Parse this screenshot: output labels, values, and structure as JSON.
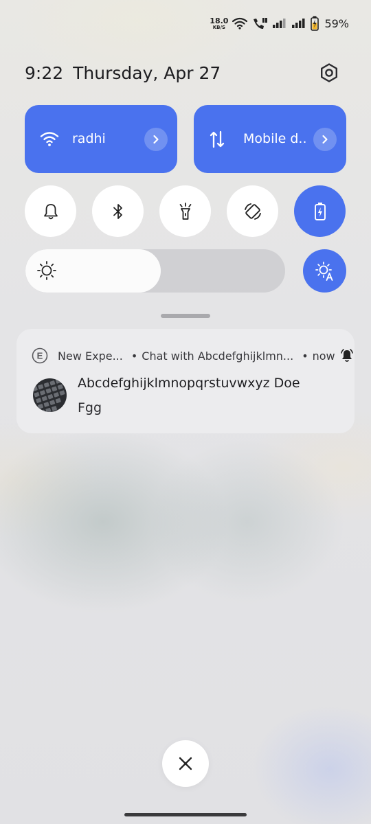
{
  "status_bar": {
    "net_speed_value": "18.0",
    "net_speed_unit": "KB/S",
    "battery_percent": "59%"
  },
  "header": {
    "time": "9:22",
    "date": "Thursday, Apr 27"
  },
  "tiles": {
    "wifi_label": "radhi",
    "mobile_label": "Mobile d.."
  },
  "brightness": {
    "level": 0.52
  },
  "notification": {
    "app_letter": "E",
    "app_name": "New Expe...",
    "bullet": "•",
    "channel": "Chat with Abcdefghijklmn...",
    "time": "now",
    "title": "Abcdefghijklmnopqrstuvwxyz Doe",
    "body": "Fgg"
  },
  "colors": {
    "accent": "#4a72ee",
    "panel": "#e6e6e8"
  },
  "icons": {
    "wifi": "wifi-icon",
    "mobile_data": "mobile-data-icon",
    "settings": "gear-icon",
    "bell": "bell-icon",
    "bluetooth": "bluetooth-icon",
    "flashlight": "flashlight-icon",
    "rotate": "auto-rotate-icon",
    "battery_saver": "battery-saver-icon",
    "brightness": "sun-icon",
    "auto_brightness": "auto-brightness-icon",
    "close": "close-icon"
  }
}
